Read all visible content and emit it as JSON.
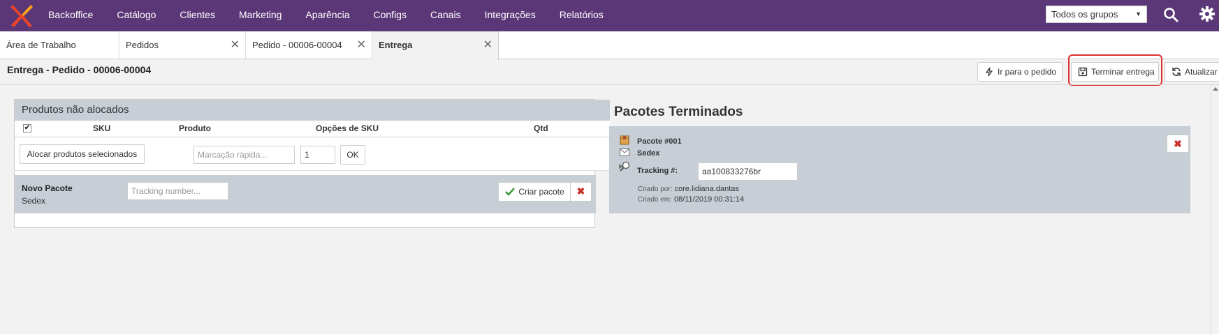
{
  "nav": {
    "items": [
      "Backoffice",
      "Catálogo",
      "Clientes",
      "Marketing",
      "Aparência",
      "Configs",
      "Canais",
      "Integrações",
      "Relatórios"
    ],
    "group_select": "Todos os grupos"
  },
  "tabs": [
    {
      "label": "Área de Trabalho"
    },
    {
      "label": "Pedidos"
    },
    {
      "label": "Pedido - 00006-00004"
    },
    {
      "label": "Entrega"
    }
  ],
  "page": {
    "title": "Entrega - Pedido - 00006-00004",
    "toolbar": {
      "goto_order": "Ir para o pedido",
      "finish_delivery": "Terminar entrega",
      "refresh": "Atualizar"
    }
  },
  "unallocated": {
    "title": "Produtos não alocados",
    "columns": {
      "sku": "SKU",
      "product": "Produto",
      "sku_options": "Opções de SKU",
      "qty": "Qtd"
    },
    "allocate_button": "Alocar produtos selecionados",
    "quick_mark_placeholder": "Marcação rápida...",
    "qty_value": "1",
    "ok_button": "OK"
  },
  "new_package": {
    "title": "Novo Pacote",
    "carrier": "Sedex",
    "tracking_placeholder": "Tracking number...",
    "create_button": "Criar pacote"
  },
  "finished": {
    "title": "Pacotes Terminados",
    "package": {
      "name": "Pacote #001",
      "carrier": "Sedex",
      "tracking_label": "Tracking #:",
      "tracking_value": "aa100833276br",
      "created_by_label": "Criado por:",
      "created_by": "core.lidiana.dantas",
      "created_at_label": "Criado em:",
      "created_at": "08/11/2019 00:31:14"
    }
  },
  "colors": {
    "topbar": "#5b3778",
    "panel_header": "#c7ced6",
    "highlight": "#e0302b",
    "danger": "#c9302c",
    "success": "#3a9a3a"
  }
}
